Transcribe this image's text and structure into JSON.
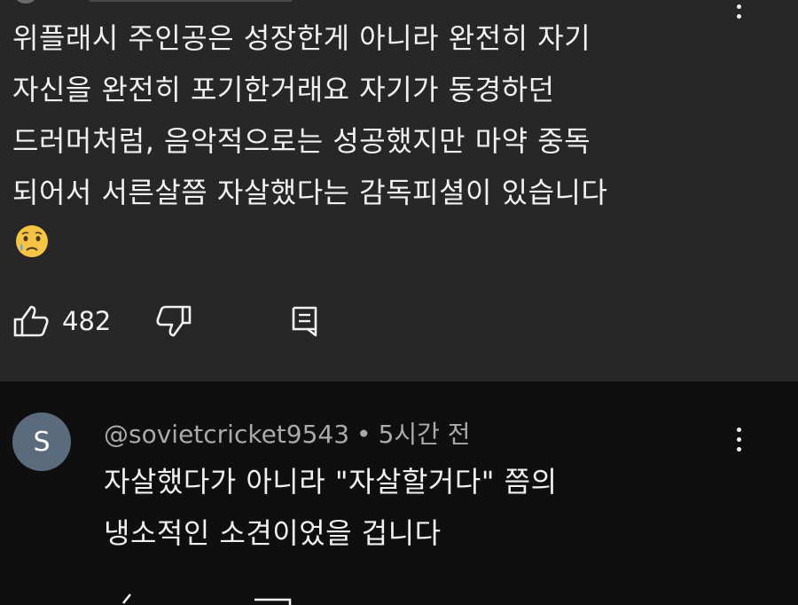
{
  "top_comment": {
    "lines": [
      "위플래시 주인공은 성장한게 아니라 완전히 자기",
      "자신을 완전히 포기한거래요 자기가 동경하던",
      "드러머처럼, 음악적으로는 성공했지만 마약 중독",
      "되어서 서른살쯤 자살했다는 감독피셜이 있습니다"
    ],
    "emoji": "crying-face",
    "like_count": "482"
  },
  "reply": {
    "avatar_letter": "S",
    "author": "@sovietcricket9543",
    "separator": "•",
    "time": "5시간 전",
    "lines": [
      "자살했다가 아니라 \"자살할거다\" 쯤의",
      "냉소적인 소견이었을 겁니다"
    ]
  },
  "colors": {
    "background": "#0f0f0f",
    "highlight_panel": "#272727",
    "avatar": "#596b7c",
    "text": "#f1f1f1",
    "meta_text": "#aaaaaa"
  }
}
